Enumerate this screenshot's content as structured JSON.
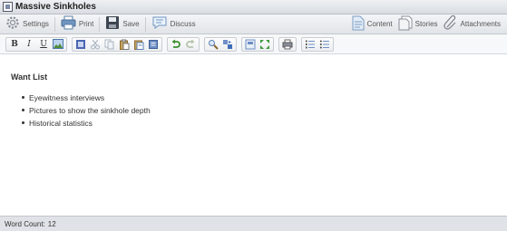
{
  "window": {
    "title": "Massive Sinkholes"
  },
  "mainbar": {
    "settings_label": "Settings",
    "print_label": "Print",
    "save_label": "Save",
    "discuss_label": "Discuss",
    "content_label": "Content",
    "stories_label": "Stories",
    "attachments_label": "Attachments"
  },
  "format_toolbar": {
    "bold": "B",
    "italic": "I",
    "underline": "U"
  },
  "document": {
    "heading": "Want List",
    "items": [
      "Eyewitness interviews",
      "Pictures to show the sinkhole depth",
      "Historical statistics"
    ]
  },
  "status": {
    "word_count_label": "Word Count:",
    "word_count": "12"
  },
  "colors": {
    "accent": "#2d6fb8",
    "toolbar_bg": "#e6e9ed",
    "status_bg": "#dfe2e6"
  }
}
